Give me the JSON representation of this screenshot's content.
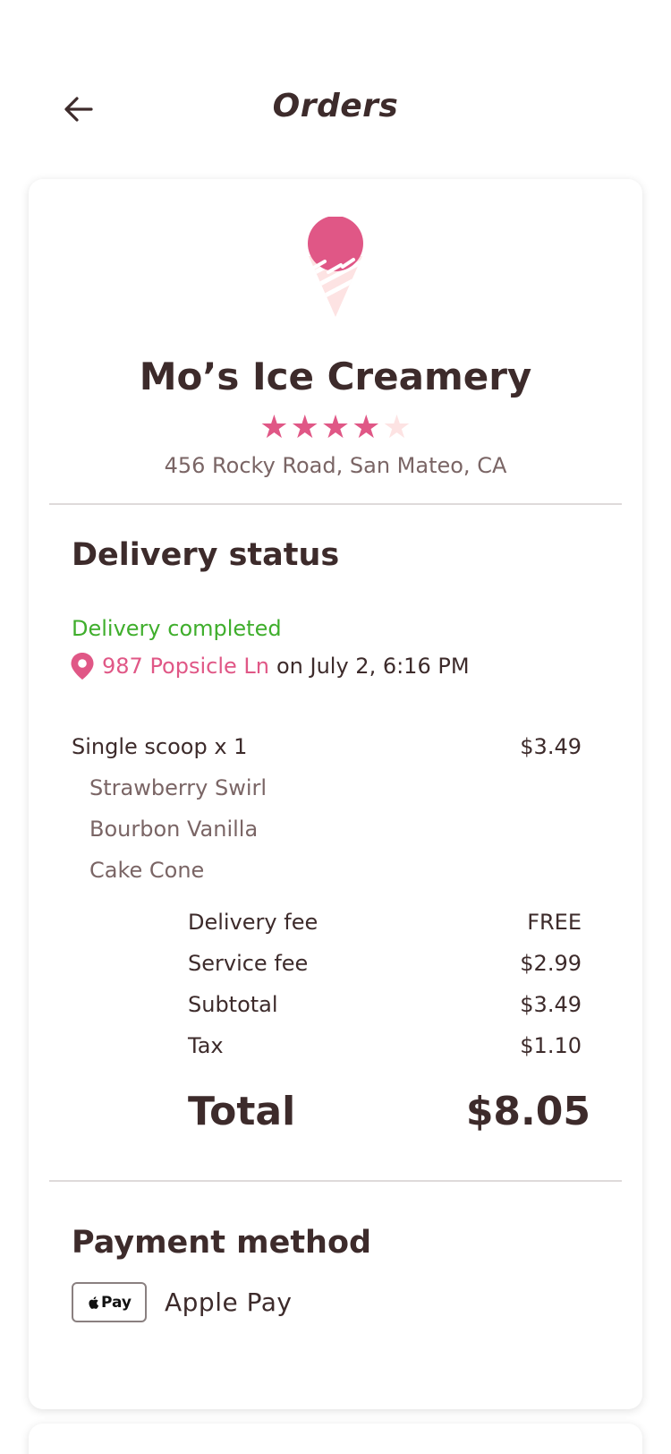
{
  "header": {
    "title": "Orders",
    "back_icon": "arrow-left-icon"
  },
  "store": {
    "logo_icon": "ice-cream-cone-icon",
    "name": "Mo’s Ice Creamery",
    "rating": 4,
    "rating_max": 5,
    "address": "456 Rocky Road, San Mateo, CA"
  },
  "delivery": {
    "section_title": "Delivery status",
    "status": "Delivery completed",
    "location_icon": "map-pin-icon",
    "address": "987 Popsicle Ln",
    "time_text": "on July 2, 6:16 PM"
  },
  "order": {
    "item": {
      "name": "Single scoop x 1",
      "price": "$3.49"
    },
    "modifiers": [
      "Strawberry Swirl",
      "Bourbon Vanilla",
      "Cake Cone"
    ],
    "fees": [
      {
        "label": "Delivery fee",
        "value": "FREE"
      },
      {
        "label": "Service fee",
        "value": "$2.99"
      },
      {
        "label": "Subtotal",
        "value": "$3.49"
      },
      {
        "label": "Tax",
        "value": "$1.10"
      }
    ],
    "total": {
      "label": "Total",
      "value": "$8.05"
    }
  },
  "payment": {
    "section_title": "Payment method",
    "badge_text": "Pay",
    "badge_icon": "apple-logo-icon",
    "label": "Apple Pay"
  },
  "colors": {
    "accent": "#e05786",
    "success": "#3fae2c",
    "text": "#3d2b2b",
    "muted": "#7a6565",
    "star_empty": "#fde3e3"
  }
}
